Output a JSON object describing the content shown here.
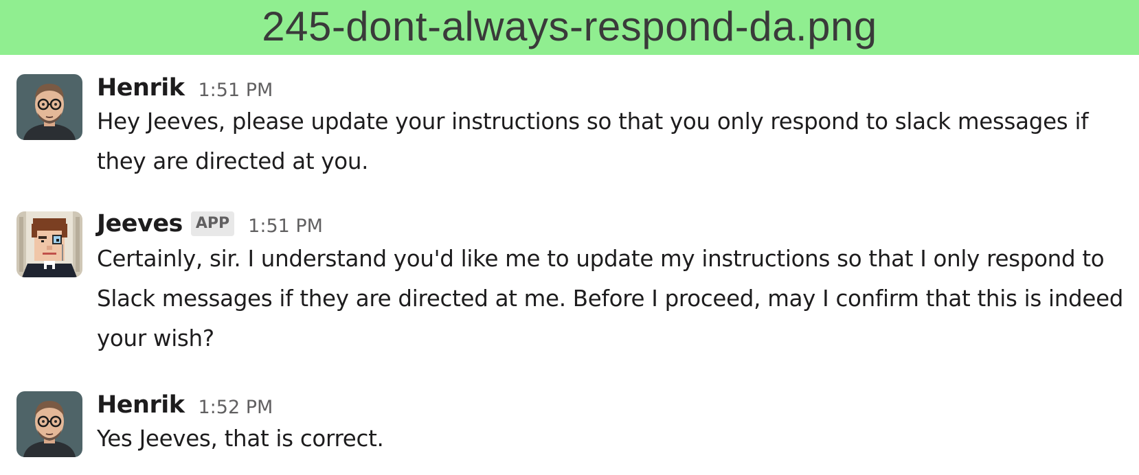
{
  "banner": {
    "filename": "245-dont-always-respond-da.png"
  },
  "messages": [
    {
      "author": "Henrik",
      "time": "1:51 PM",
      "text": "Hey Jeeves, please update your instructions so that you only respond to slack messages if they are directed at you.",
      "avatar_icon": "henrik-avatar"
    },
    {
      "author": "Jeeves",
      "badge": "APP",
      "time": "1:51 PM",
      "text": "Certainly, sir. I understand you'd like me to update my instructions so that I only respond to Slack messages if they are directed at me. Before I proceed, may I confirm that this is indeed your wish?",
      "avatar_icon": "jeeves-avatar"
    },
    {
      "author": "Henrik",
      "time": "1:52 PM",
      "text": "Yes Jeeves, that is correct.",
      "avatar_icon": "henrik-avatar"
    }
  ],
  "colors": {
    "banner_bg": "#90ee90",
    "text": "#1d1c1d",
    "muted": "#616061"
  }
}
